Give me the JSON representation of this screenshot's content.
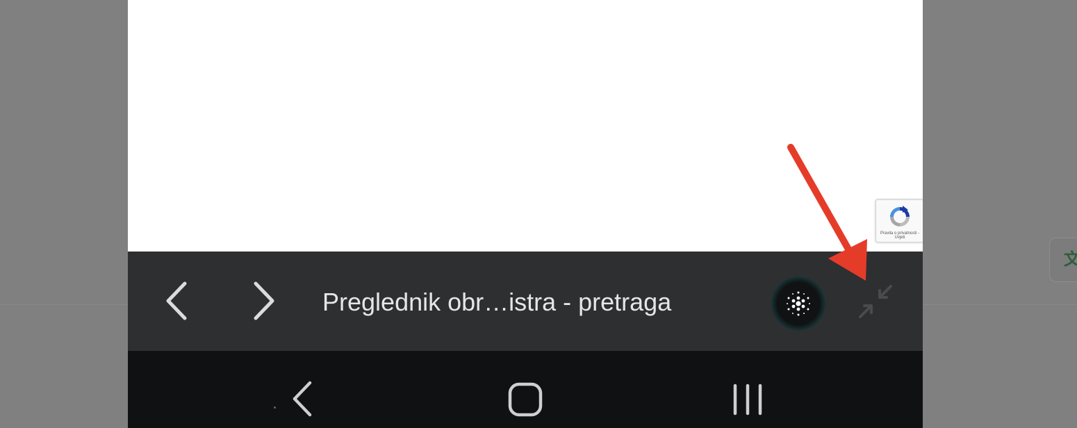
{
  "browser_toolbar": {
    "page_title": "Preglednik obr…istra - pretraga"
  },
  "recaptcha": {
    "text": "Pravila o privatnosti - Uvjeti"
  },
  "background_chip": {
    "glyph": "文A"
  },
  "icons": {
    "toolbar": [
      "chevron-left-icon",
      "chevron-right-icon",
      "ai-assistant-icon",
      "minimize-arrows-icon"
    ],
    "navbar": [
      "back-icon",
      "home-icon",
      "recents-icon"
    ]
  },
  "colors": {
    "toolbar_bg": "#2e2f31",
    "navbar_bg": "#101113",
    "annotation_arrow": "#e53c2a",
    "ai_ring": "#3f8b89"
  }
}
